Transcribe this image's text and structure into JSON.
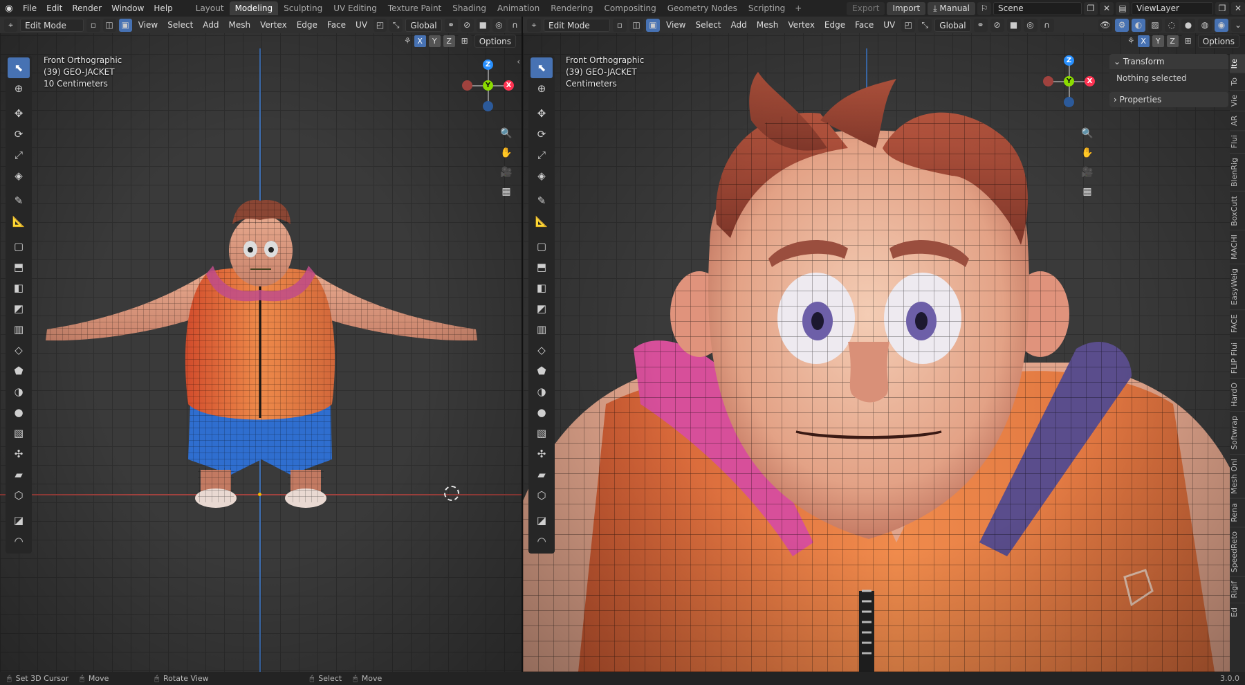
{
  "topbar": {
    "menus": [
      "File",
      "Edit",
      "Render",
      "Window",
      "Help"
    ],
    "workspaces": [
      "Layout",
      "Modeling",
      "Sculpting",
      "UV Editing",
      "Texture Paint",
      "Shading",
      "Animation",
      "Rendering",
      "Compositing",
      "Geometry Nodes",
      "Scripting"
    ],
    "active_workspace": "Modeling",
    "export_label": "Export",
    "import_label": "Import",
    "manual_label": "Manual",
    "scene": "Scene",
    "view_layer": "ViewLayer"
  },
  "viewport_left": {
    "mode": "Edit Mode",
    "menus": [
      "View",
      "Select",
      "Add",
      "Mesh",
      "Vertex",
      "Edge",
      "Face",
      "UV"
    ],
    "orientation": "Global",
    "axes": [
      "X",
      "Y",
      "Z"
    ],
    "options": "Options",
    "overlay": [
      "Front Orthographic",
      "(39) GEO-JACKET",
      "10 Centimeters"
    ]
  },
  "viewport_right": {
    "mode": "Edit Mode",
    "menus": [
      "View",
      "Select",
      "Add",
      "Mesh",
      "Vertex",
      "Edge",
      "Face",
      "UV"
    ],
    "orientation": "Global",
    "axes": [
      "X",
      "Y",
      "Z"
    ],
    "options": "Options",
    "overlay": [
      "Front Orthographic",
      "(39) GEO-JACKET",
      "Centimeters"
    ]
  },
  "npanel": {
    "transform": "Transform",
    "nothing_selected": "Nothing selected",
    "properties": "Properties",
    "tabs": [
      "Ite",
      "To",
      "Vie",
      "AR",
      "Flui",
      "BlenRig",
      "BoxCutt",
      "MACHI",
      "EasyWeig",
      "FACE",
      "FLIP Flui",
      "HardO",
      "Softwrap",
      "Mesh Onl",
      "Rena",
      "SpeedReto",
      "Rigif",
      "Ed"
    ]
  },
  "gizmo": {
    "z": "Z",
    "y": "Y",
    "x": "X"
  },
  "statusbar": {
    "items": [
      "Set 3D Cursor",
      "Move",
      "Rotate View",
      "Select",
      "Move"
    ],
    "version": "3.0.0"
  },
  "colors": {
    "accent": "#4772b3",
    "x_axis": "#ff3352",
    "y_axis": "#8bdc00",
    "z_axis": "#2890ff",
    "bg": "#1d1d1d"
  }
}
